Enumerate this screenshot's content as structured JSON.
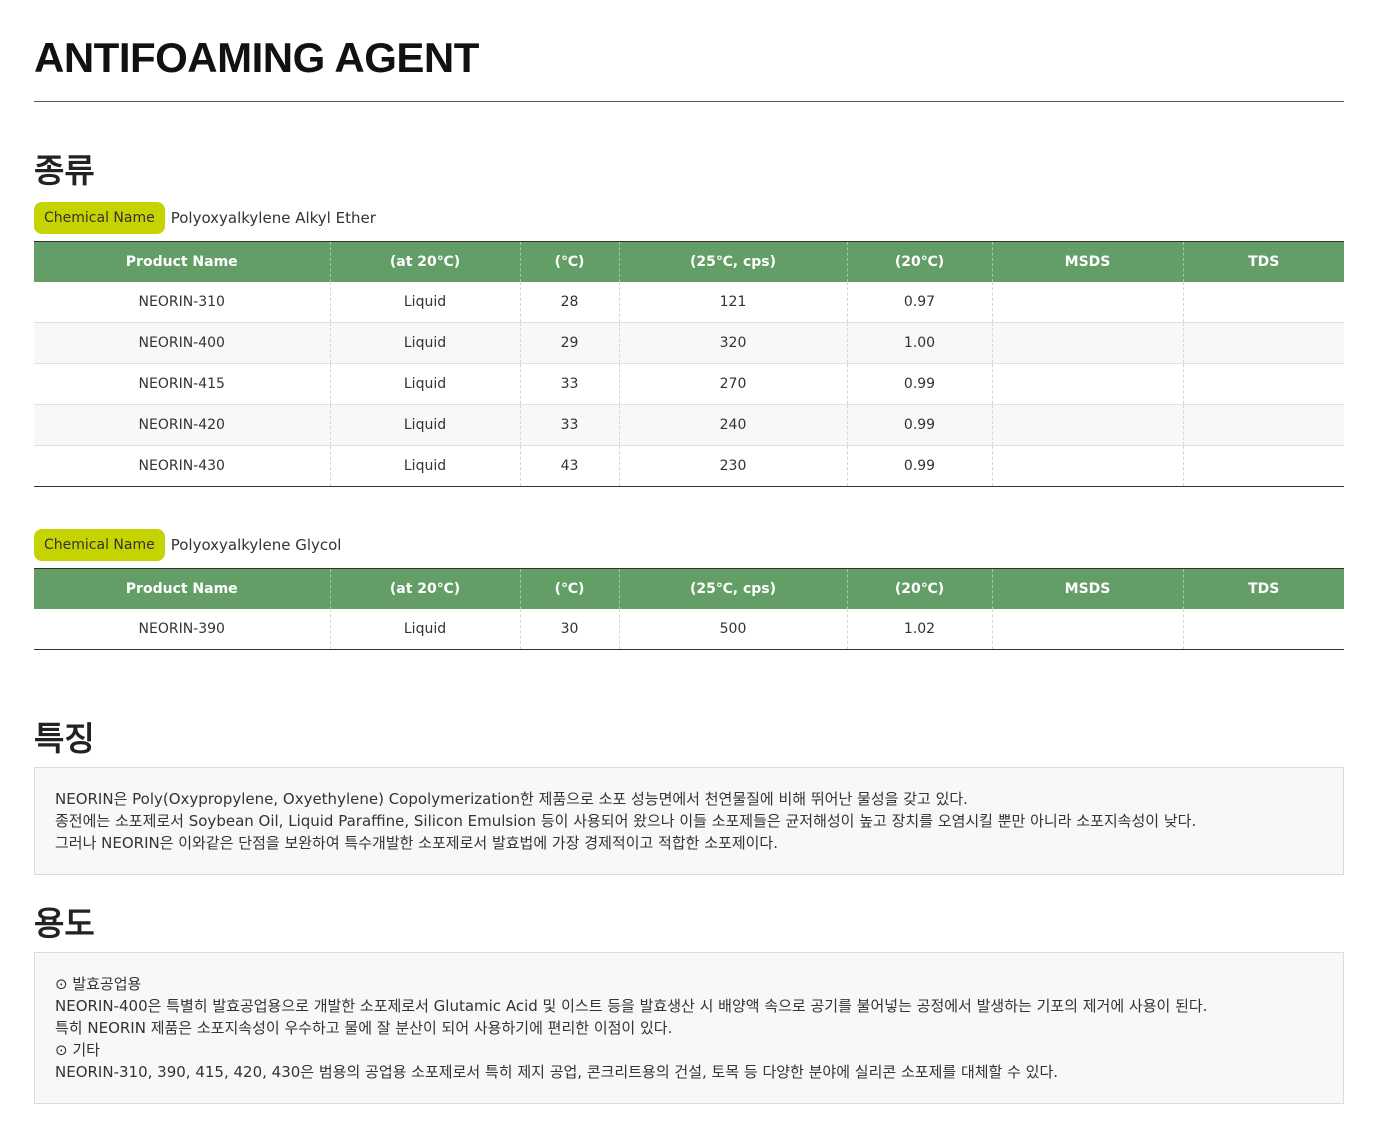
{
  "page": {
    "title": "ANTIFOAMING AGENT"
  },
  "types_section": {
    "heading": "종류",
    "tables": [
      {
        "chemical_label": "Chemical Name",
        "chemical_name": "Polyoxyalkylene Alkyl Ether",
        "columns": [
          "Product Name",
          "(at 20℃)",
          "(℃)",
          "(25℃, cps)",
          "(20℃)",
          "MSDS",
          "TDS"
        ],
        "rows": [
          [
            "NEORIN-310",
            "Liquid",
            "28",
            "121",
            "0.97",
            "",
            ""
          ],
          [
            "NEORIN-400",
            "Liquid",
            "29",
            "320",
            "1.00",
            "",
            ""
          ],
          [
            "NEORIN-415",
            "Liquid",
            "33",
            "270",
            "0.99",
            "",
            ""
          ],
          [
            "NEORIN-420",
            "Liquid",
            "33",
            "240",
            "0.99",
            "",
            ""
          ],
          [
            "NEORIN-430",
            "Liquid",
            "43",
            "230",
            "0.99",
            "",
            ""
          ]
        ]
      },
      {
        "chemical_label": "Chemical Name",
        "chemical_name": "Polyoxyalkylene Glycol",
        "columns": [
          "Product Name",
          "(at 20℃)",
          "(℃)",
          "(25℃, cps)",
          "(20℃)",
          "MSDS",
          "TDS"
        ],
        "rows": [
          [
            "NEORIN-390",
            "Liquid",
            "30",
            "500",
            "1.02",
            "",
            ""
          ]
        ]
      }
    ]
  },
  "features_section": {
    "heading": "특징",
    "lines": [
      "NEORIN은 Poly(Oxypropylene, Oxyethylene) Copolymerization한 제품으로 소포 성능면에서 천연물질에 비해 뛰어난 물성을 갖고 있다.",
      "종전에는 소포제로서 Soybean Oil, Liquid Paraffine, Silicon Emulsion 등이 사용되어 왔으나 이들 소포제들은 균저해성이 높고 장치를 오염시킬 뿐만 아니라 소포지속성이 낮다.",
      "그러나 NEORIN은 이와같은 단점을 보완하여 특수개발한 소포제로서 발효법에 가장 경제적이고 적합한 소포제이다."
    ]
  },
  "uses_section": {
    "heading": "용도",
    "lines": [
      "⊙ 발효공업용",
      "NEORIN-400은 특별히 발효공업용으로 개발한 소포제로서 Glutamic Acid 및 이스트 등을 발효생산 시 배양액 속으로 공기를 불어넣는 공정에서 발생하는 기포의 제거에 사용이 된다.",
      "특히 NEORIN 제품은 소포지속성이 우수하고 물에 잘 분산이 되어 사용하기에 편리한 이점이 있다.",
      "⊙ 기타",
      "NEORIN-310, 390, 415, 420, 430은 범용의 공업용 소포제로서 특히 제지 공업, 콘크리트용의 건설, 토목 등 다양한 분야에 실리콘 소포제를 대체할 수 있다."
    ]
  }
}
